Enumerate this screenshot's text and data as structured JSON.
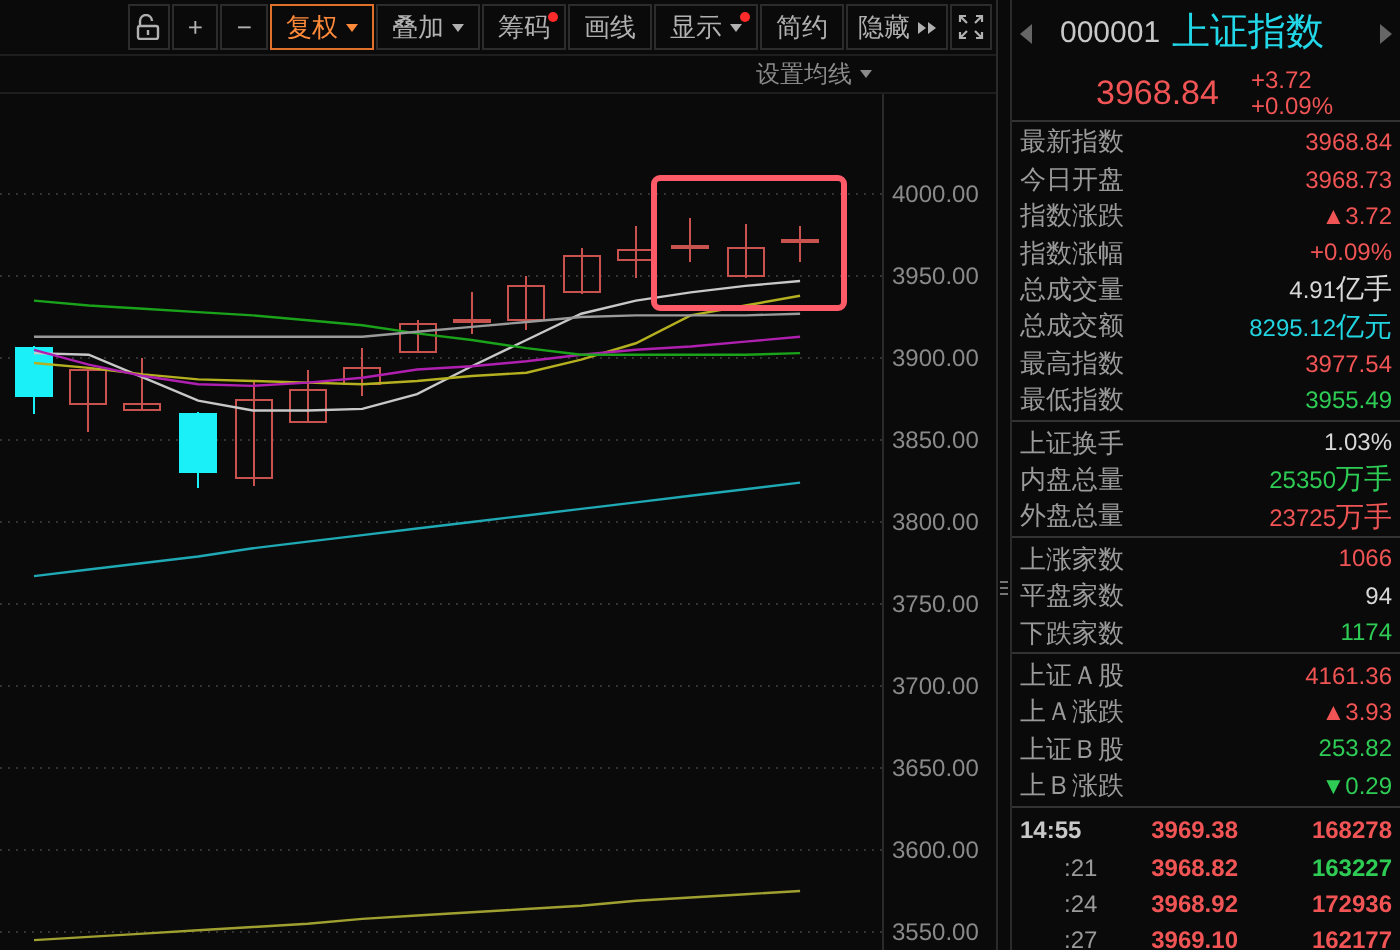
{
  "toolbar": {
    "buttons": [
      {
        "kind": "lock",
        "selected": false
      },
      {
        "kind": "text",
        "label": "+",
        "selected": false,
        "dropdown": false,
        "alert_dot": false
      },
      {
        "kind": "text",
        "label": "−",
        "selected": false,
        "dropdown": false,
        "alert_dot": false
      },
      {
        "kind": "text",
        "label": "复权",
        "selected": true,
        "dropdown": true,
        "alert_dot": false
      },
      {
        "kind": "text",
        "label": "叠加",
        "selected": false,
        "dropdown": true,
        "alert_dot": false
      },
      {
        "kind": "text",
        "label": "筹码",
        "selected": false,
        "dropdown": false,
        "alert_dot": true
      },
      {
        "kind": "text",
        "label": "画线",
        "selected": false,
        "dropdown": false,
        "alert_dot": false
      },
      {
        "kind": "text",
        "label": "显示",
        "selected": false,
        "dropdown": true,
        "alert_dot": true
      },
      {
        "kind": "text",
        "label": "简约",
        "selected": false,
        "dropdown": false,
        "alert_dot": false
      },
      {
        "kind": "collapse",
        "label": "隐藏",
        "selected": false
      },
      {
        "kind": "fullscreen",
        "selected": false
      }
    ]
  },
  "chart": {
    "ma_settings": "设置均线",
    "chart_data": {
      "type": "line",
      "grid": true,
      "ylim": [
        3539,
        4061
      ],
      "categories": [
        null,
        null,
        null,
        null,
        null,
        null,
        null,
        null,
        null,
        null,
        null,
        null,
        null,
        null,
        null
      ],
      "yticks": [
        {
          "value": 4000,
          "label": "4000.00"
        },
        {
          "value": 3950,
          "label": "3950.00"
        },
        {
          "value": 3900,
          "label": "3900.00"
        },
        {
          "value": 3850,
          "label": "3850.00"
        },
        {
          "value": 3800,
          "label": "3800.00"
        },
        {
          "value": 3750,
          "label": "3750.00"
        },
        {
          "value": 3700,
          "label": "3700.00"
        },
        {
          "value": 3650,
          "label": "3650.00"
        },
        {
          "value": 3600,
          "label": "3600.00"
        },
        {
          "value": 3550,
          "label": "3550.00"
        }
      ],
      "series": [
        {
          "color": "#c8c8c8",
          "values": [
            3903,
            3902,
            3888,
            3874,
            3868,
            3868,
            3869,
            3878,
            3895,
            3911,
            3927,
            3935,
            3940,
            3944,
            3947
          ]
        },
        {
          "color": "#b5b020",
          "values": [
            3897,
            3894,
            3890,
            3887,
            3886,
            3885,
            3884,
            3886,
            3889,
            3891,
            3899,
            3909,
            3926,
            3932,
            3938
          ]
        },
        {
          "color": "#b020b0",
          "values": [
            3905,
            3896,
            3889,
            3884,
            3883,
            3885,
            3888,
            3893,
            3895,
            3898,
            3902,
            3905,
            3907,
            3910,
            3913
          ]
        },
        {
          "color": "#1aa31a",
          "values": [
            3935,
            3932,
            3930,
            3928,
            3926,
            3923,
            3920,
            3915,
            3911,
            3906,
            3902,
            3902,
            3902,
            3902,
            3903
          ]
        },
        {
          "color": "#9a9a9a",
          "values": [
            3913,
            3913,
            3913,
            3913,
            3913,
            3913,
            3913,
            3916,
            3919,
            3922,
            3925,
            3926,
            3926,
            3926,
            3927
          ]
        },
        {
          "color": "#1fa9b5",
          "values": [
            3767,
            3771,
            3775,
            3779,
            3784,
            3788,
            3792,
            3796,
            3800,
            3804,
            3808,
            3812,
            3816,
            3820,
            3824
          ]
        },
        {
          "color": "#a0a030",
          "values": [
            3545,
            3547,
            3549,
            3551,
            3553,
            3555,
            3558,
            3560,
            3562,
            3564,
            3566,
            3569,
            3571,
            3573,
            3575
          ]
        }
      ]
    }
  },
  "quote": {
    "code": "000001",
    "name": "上证指数",
    "price": "3968.84",
    "change": "+3.72",
    "change_pct": "+0.09%"
  },
  "stats": [
    [
      {
        "label": "最新指数",
        "value": "3968.84",
        "color": "#f05454"
      },
      {
        "label": "今日开盘",
        "value": "3968.73",
        "color": "#f05454"
      },
      {
        "label": "指数涨跌",
        "value": "▲3.72",
        "color": "#f05454"
      },
      {
        "label": "指数涨幅",
        "value": "+0.09%",
        "color": "#f05454"
      },
      {
        "label": "总成交量",
        "value": "4.91",
        "unit": "亿手",
        "color": "#d8d8d8"
      },
      {
        "label": "总成交额",
        "value": "8295.12",
        "unit": "亿元",
        "color": "#22d3e0"
      },
      {
        "label": "最高指数",
        "value": "3977.54",
        "color": "#f05454"
      },
      {
        "label": "最低指数",
        "value": "3955.49",
        "color": "#2ecc55"
      }
    ],
    [
      {
        "label": "上证换手",
        "value": "1.03%",
        "color": "#d8d8d8"
      },
      {
        "label": "内盘总量",
        "value": "25350",
        "unit": "万手",
        "color": "#2ecc55"
      },
      {
        "label": "外盘总量",
        "value": "23725",
        "unit": "万手",
        "color": "#f05454"
      }
    ],
    [
      {
        "label": "上涨家数",
        "value": "1066",
        "color": "#f05454"
      },
      {
        "label": "平盘家数",
        "value": "94",
        "color": "#d8d8d8"
      },
      {
        "label": "下跌家数",
        "value": "1174",
        "color": "#2ecc55"
      }
    ],
    [
      {
        "label": "上证Ａ股",
        "value": "4161.36",
        "color": "#f05454"
      },
      {
        "label": "上Ａ涨跌",
        "value": "▲3.93",
        "color": "#f05454"
      },
      {
        "label": "上证Ｂ股",
        "value": "253.82",
        "color": "#2ecc55"
      },
      {
        "label": "上Ｂ涨跌",
        "value": "▼0.29",
        "color": "#2ecc55"
      }
    ]
  ],
  "ticks": [
    {
      "time": "14:55",
      "price": {
        "text": "3969.38",
        "color": "#f05454"
      },
      "volume": {
        "text": "168278",
        "color": "#f05454"
      }
    },
    {
      "time": ":21",
      "price": {
        "text": "3968.82",
        "color": "#f05454"
      },
      "volume": {
        "text": "163227",
        "color": "#2ecc55"
      }
    },
    {
      "time": ":24",
      "price": {
        "text": "3968.92",
        "color": "#f05454"
      },
      "volume": {
        "text": "172936",
        "color": "#f05454"
      }
    },
    {
      "time": ":27",
      "price": {
        "text": "3969.10",
        "color": "#f05454"
      },
      "volume": {
        "text": "162177",
        "color": "#f05454"
      }
    }
  ]
}
